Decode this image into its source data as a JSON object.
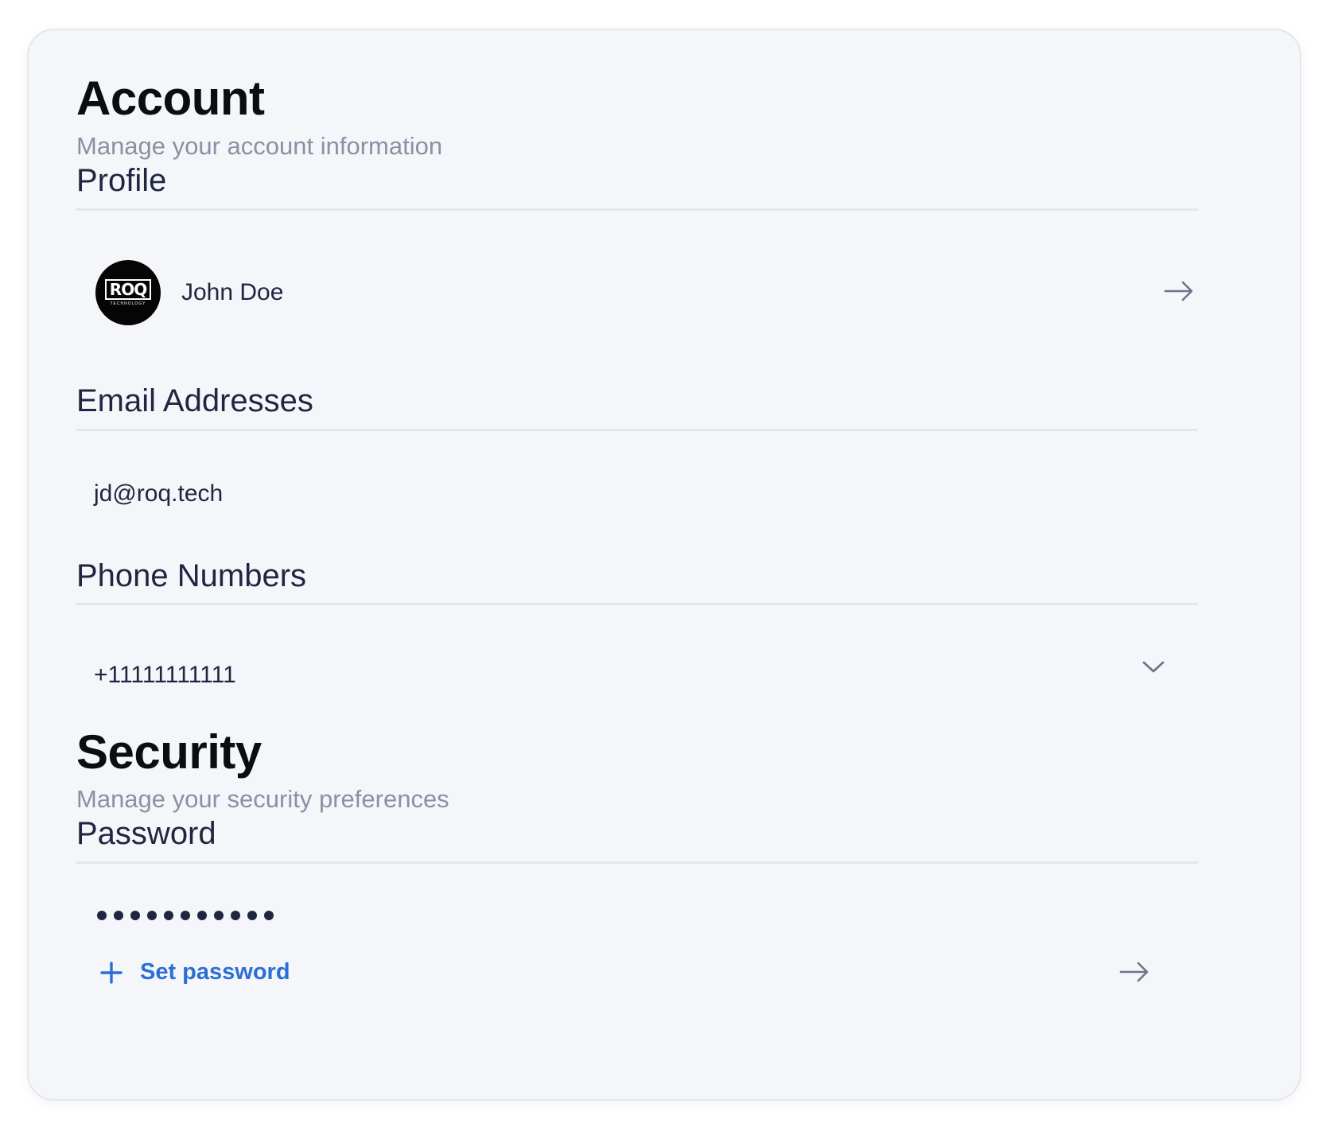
{
  "account": {
    "title": "Account",
    "subtitle": "Manage your account information"
  },
  "profile": {
    "section_title": "Profile",
    "avatar_text": "ROQ",
    "avatar_subtext": "TECHNOLOGY",
    "name": "John Doe",
    "action_icon": "arrow-right-icon"
  },
  "email": {
    "section_title": "Email Addresses",
    "value": "jd@roq.tech"
  },
  "phone": {
    "section_title": "Phone Numbers",
    "value": "+11111111111",
    "action_icon": "chevron-down-icon"
  },
  "security": {
    "title": "Security",
    "subtitle": "Manage your security preferences"
  },
  "password": {
    "section_title": "Password",
    "masked_length": 11,
    "set_label": "Set password",
    "set_icon": "plus-icon",
    "action_icon": "arrow-right-icon"
  },
  "colors": {
    "card_background": "#f5f6fa",
    "text_primary": "#1f2640",
    "text_muted": "#8b90a3",
    "accent": "#2a6fd6",
    "divider": "#e3e6ee"
  }
}
